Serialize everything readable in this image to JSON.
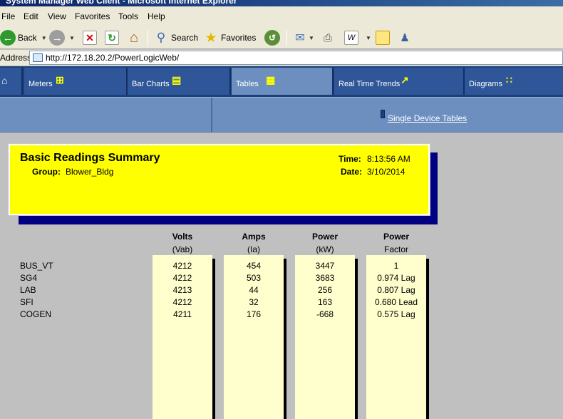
{
  "window": {
    "title": "System Manager Web Client - Microsoft Internet Explorer"
  },
  "menu": [
    "File",
    "Edit",
    "View",
    "Favorites",
    "Tools",
    "Help"
  ],
  "toolbar": {
    "back": "Back",
    "search": "Search",
    "favorites": "Favorites"
  },
  "address": {
    "label": "Address",
    "url": "http://172.18.20.2/PowerLogicWeb/"
  },
  "nav": {
    "tabs": [
      {
        "label": "Meters",
        "icon": "meters-icon"
      },
      {
        "label": "Bar Charts",
        "icon": "bar-chart-icon"
      },
      {
        "label": "Tables",
        "icon": "tables-icon",
        "active": true
      },
      {
        "label": "Real Time Trends",
        "icon": "trend-icon"
      },
      {
        "label": "Diagrams",
        "icon": "diagram-icon"
      }
    ],
    "sub_link": "Single Device Tables"
  },
  "report": {
    "title": "Basic Readings Summary",
    "group_label": "Group:",
    "group": "Blower_Bldg",
    "time_label": "Time:",
    "time": "8:13:56 AM",
    "date_label": "Date:",
    "date": "3/10/2014"
  },
  "table": {
    "columns": [
      {
        "h1": "Volts",
        "h2": "(Vab)"
      },
      {
        "h1": "Amps",
        "h2": "(Ia)"
      },
      {
        "h1": "Power",
        "h2": "(kW)"
      },
      {
        "h1": "Power",
        "h2": "Factor"
      }
    ],
    "rows": [
      {
        "name": "BUS_VT",
        "values": [
          "4212",
          "454",
          "3447",
          "1"
        ]
      },
      {
        "name": "SG4",
        "values": [
          "4212",
          "503",
          "3683",
          "0.974 Lag"
        ]
      },
      {
        "name": "LAB",
        "values": [
          "4213",
          "44",
          "256",
          "0.807 Lag"
        ]
      },
      {
        "name": "SFI",
        "values": [
          "4212",
          "32",
          "163",
          "0.680 Lead"
        ]
      },
      {
        "name": "COGEN",
        "values": [
          "4211",
          "176",
          "-668",
          "0.575 Lag"
        ]
      }
    ]
  },
  "colors": {
    "panel": "#ffff00",
    "panel_shadow": "#000080",
    "nav": "#1e3f78",
    "active_tab": "#6d8fbf",
    "column_bg": "#fffecd"
  }
}
